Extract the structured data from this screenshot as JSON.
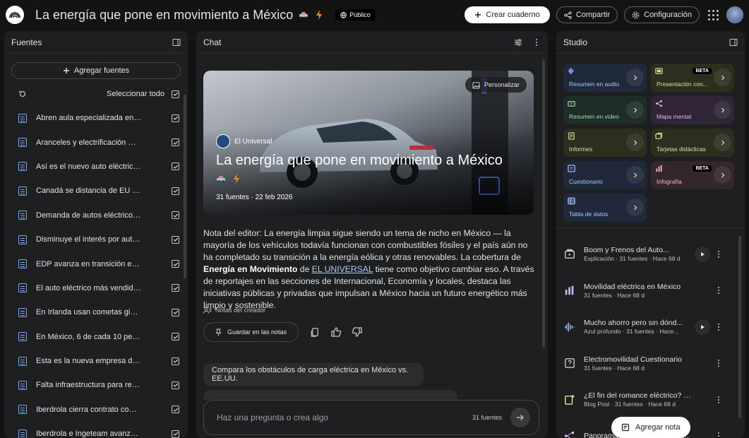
{
  "header": {
    "title": "La energía que pone en movimiento a México",
    "visibility": "Público",
    "create_notebook": "Crear cuaderno",
    "share": "Compartir",
    "settings": "Configuración"
  },
  "sources": {
    "title": "Fuentes",
    "add_label": "Agregar fuentes",
    "select_all": "Seleccionar todo",
    "items": [
      {
        "label": "Abren aula especializada en re..."
      },
      {
        "label": "Aranceles y electrificación met..."
      },
      {
        "label": "Así es el nuevo auto eléctrico h..."
      },
      {
        "label": "Canadá se distancia de EU y re..."
      },
      {
        "label": "Demanda de autos eléctricos i..."
      },
      {
        "label": "Disminuye el interés por autos ..."
      },
      {
        "label": "EDP avanza en transición energ..."
      },
      {
        "label": "El auto eléctrico más vendido e..."
      },
      {
        "label": "En Irlanda usan cometas gigant..."
      },
      {
        "label": "En México, 6 de cada 10 perso..."
      },
      {
        "label": "Esta es la nueva empresa de en..."
      },
      {
        "label": "Falta infraestructura para recar..."
      },
      {
        "label": "Iberdrola cierra contrato compr..."
      },
      {
        "label": "Iberdrola e Ingeteam avanzan e..."
      }
    ]
  },
  "chat": {
    "title": "Chat",
    "hero": {
      "personalize": "Personalizar",
      "source_name": "El Universal",
      "title": "La energía que pone en movimiento a México",
      "meta": "31 fuentes · 22 feb 2026"
    },
    "note_p1": "Nota del editor: La energía limpia sigue siendo un tema de nicho en México — la mayoría de los vehículos todavía funcionan con combustibles fósiles y el país aún no ha completado su transición a la energía eólica y otras renovables. La cobertura de ",
    "note_bold": "Energía en Movimiento",
    "note_p2": " de ",
    "note_link": "EL UNIVERSAL",
    "note_p3": " tiene como objetivo cambiar eso. A través de reportajes en las secciones de Internacional, Economía y locales, destaca las iniciativas públicas y privadas que impulsan a México hacia un futuro energético más limpio y sostenible.",
    "creator_notes": "Notas del creador",
    "save_note": "Guardar en las notas",
    "suggested_prompt": "Compara los obstáculos de carga eléctrica en México vs. EE.UU.",
    "input_placeholder": "Haz una pregunta o crea algo",
    "source_count": "31 fuentes"
  },
  "studio": {
    "title": "Studio",
    "tiles": [
      {
        "label": "Resumen en audio",
        "icon": "audio-waveform-icon"
      },
      {
        "label": "Presentación con...",
        "icon": "slides-icon",
        "badge": "BETA"
      },
      {
        "label": "Resumen en video",
        "icon": "video-icon"
      },
      {
        "label": "Mapa mental",
        "icon": "mind-map-icon"
      },
      {
        "label": "Informes",
        "icon": "report-icon"
      },
      {
        "label": "Tarjetas didácticas",
        "icon": "flashcards-icon"
      },
      {
        "label": "Cuestionario",
        "icon": "quiz-icon"
      },
      {
        "label": "Infografía",
        "icon": "infographic-icon",
        "badge": "BETA"
      },
      {
        "label": "Tabla de datos",
        "icon": "table-icon"
      }
    ],
    "notes": [
      {
        "title": "Boom y Frenos del Auto...",
        "meta": "Explicación · 31 fuentes · Hace 68 d"
      },
      {
        "title": "Movilidad eléctrica en México",
        "meta": "31 fuentes · Hace 68 d"
      },
      {
        "title": "Mucho ahorro pero sin dónd...",
        "meta": "Azul profundo · 31 fuentes · Hace..."
      },
      {
        "title": "Electromovilidad Cuestionario",
        "meta": "31 fuentes · Hace 68 d"
      },
      {
        "title": "¿El fin del romance eléctrico? 5...",
        "meta": "Blog Post · 31 fuentes · Hace 68 d"
      },
      {
        "title": "Panorama de la transición eléctric...",
        "meta": ""
      }
    ],
    "add_note": "Agregar nota"
  },
  "colors": {
    "background": "#131314",
    "panel": "#1e1f20",
    "accent_link": "#a8c7fa"
  }
}
